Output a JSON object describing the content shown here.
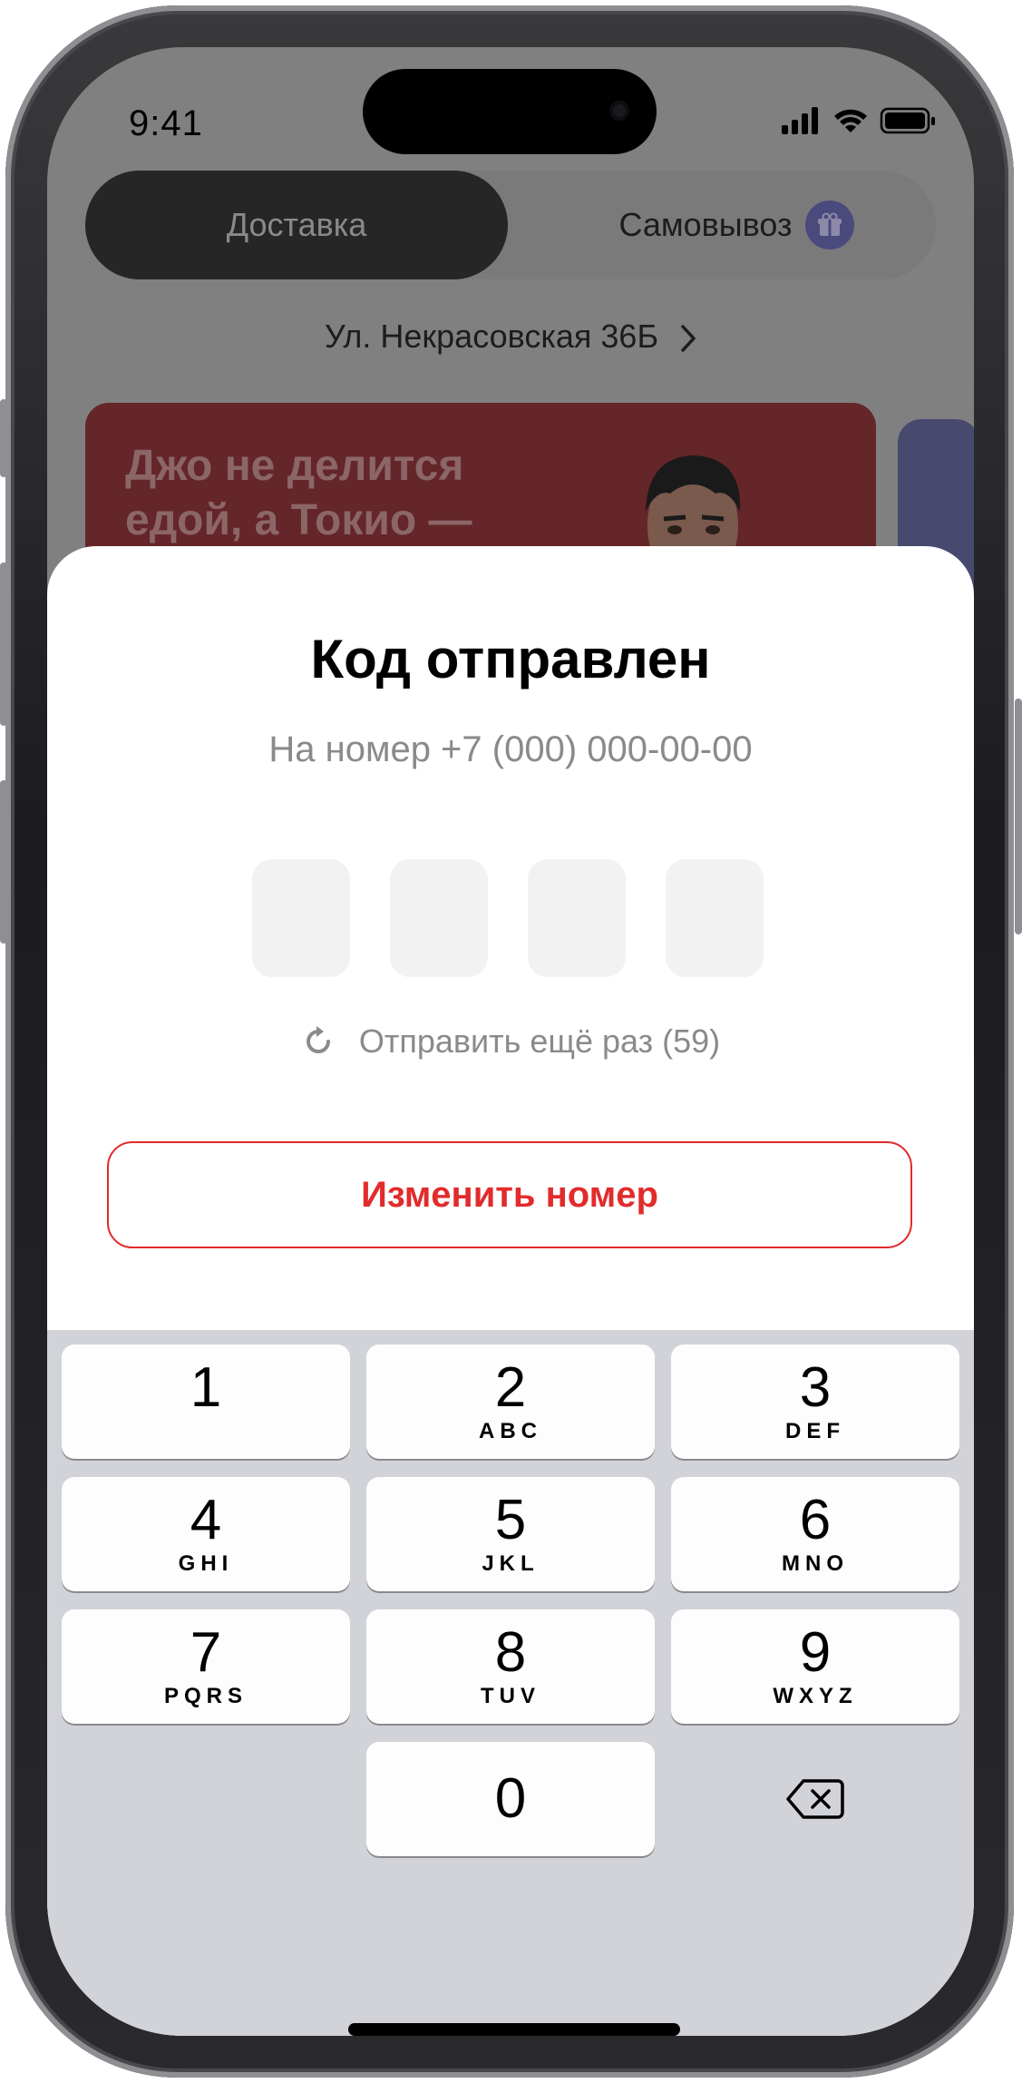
{
  "status_bar": {
    "time": "9:41"
  },
  "delivery_toggle": {
    "delivery_label": "Доставка",
    "pickup_label": "Самовывоз"
  },
  "address": "Ул. Некрасовская 36Б",
  "banner": {
    "text": "Джо не делится едой, а Токио —"
  },
  "sheet": {
    "title": "Код отправлен",
    "subtitle": "На номер +7 (000) 000-00-00",
    "resend_label": "Отправить ещё раз (59)",
    "change_number_label": "Изменить номер"
  },
  "keypad": {
    "keys": [
      {
        "num": "1",
        "letters": ""
      },
      {
        "num": "2",
        "letters": "ABC"
      },
      {
        "num": "3",
        "letters": "DEF"
      },
      {
        "num": "4",
        "letters": "GHI"
      },
      {
        "num": "5",
        "letters": "JKL"
      },
      {
        "num": "6",
        "letters": "MNO"
      },
      {
        "num": "7",
        "letters": "PQRS"
      },
      {
        "num": "8",
        "letters": "TUV"
      },
      {
        "num": "9",
        "letters": "WXYZ"
      },
      {
        "num": "0",
        "letters": ""
      }
    ]
  },
  "colors": {
    "accent": "#e22b2b",
    "banner_bg": "#642628",
    "sheet_bg": "#ffffff",
    "keyboard_bg": "#d1d3d9"
  },
  "icons": [
    "refresh-icon",
    "chevron-right-icon",
    "gift-icon",
    "backspace-icon",
    "signal-icon",
    "wifi-icon",
    "battery-icon"
  ]
}
